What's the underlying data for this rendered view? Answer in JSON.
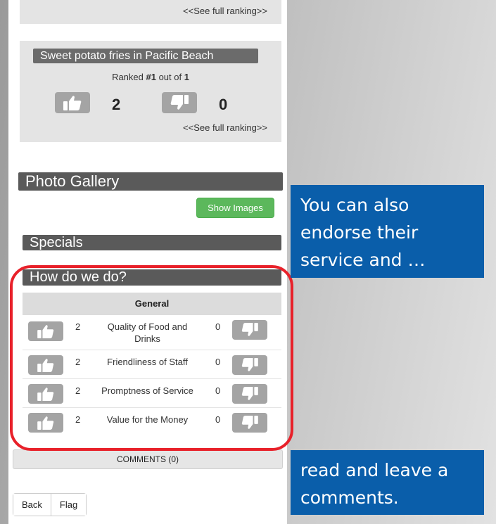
{
  "top_panel": {
    "see_full": "<<See full ranking>>"
  },
  "ranking_card": {
    "title": "Sweet potato fries in Pacific Beach",
    "ranked_prefix": "Ranked ",
    "ranked_value": "#1",
    "ranked_suffix": " out of ",
    "ranked_total": "1",
    "up_count": "2",
    "down_count": "0",
    "see_full": "<<See full ranking>>"
  },
  "gallery": {
    "title": "Photo Gallery",
    "show_images_label": "Show Images"
  },
  "specials": {
    "title": "Specials"
  },
  "rating": {
    "title": "How do we do?",
    "table_header": "General",
    "rows": [
      {
        "label": "Quality of Food and Drinks",
        "up": "2",
        "down": "0"
      },
      {
        "label": "Friendliness of Staff",
        "up": "2",
        "down": "0"
      },
      {
        "label": "Promptness of Service",
        "up": "2",
        "down": "0"
      },
      {
        "label": "Value for the Money",
        "up": "2",
        "down": "0"
      }
    ]
  },
  "comments": {
    "label": "COMMENTS (0)"
  },
  "footer": {
    "back_label": "Back",
    "flag_label": "Flag"
  },
  "callouts": [
    {
      "text": "You can also endorse their service and …"
    },
    {
      "text": "read and leave a comments."
    }
  ],
  "colors": {
    "section_bar": "#5a5a5a",
    "show_images_green": "#5cb85c",
    "highlight_red": "#e8212a",
    "callout_blue": "#0a5eaa",
    "thumb_button": "#a4a4a4"
  }
}
